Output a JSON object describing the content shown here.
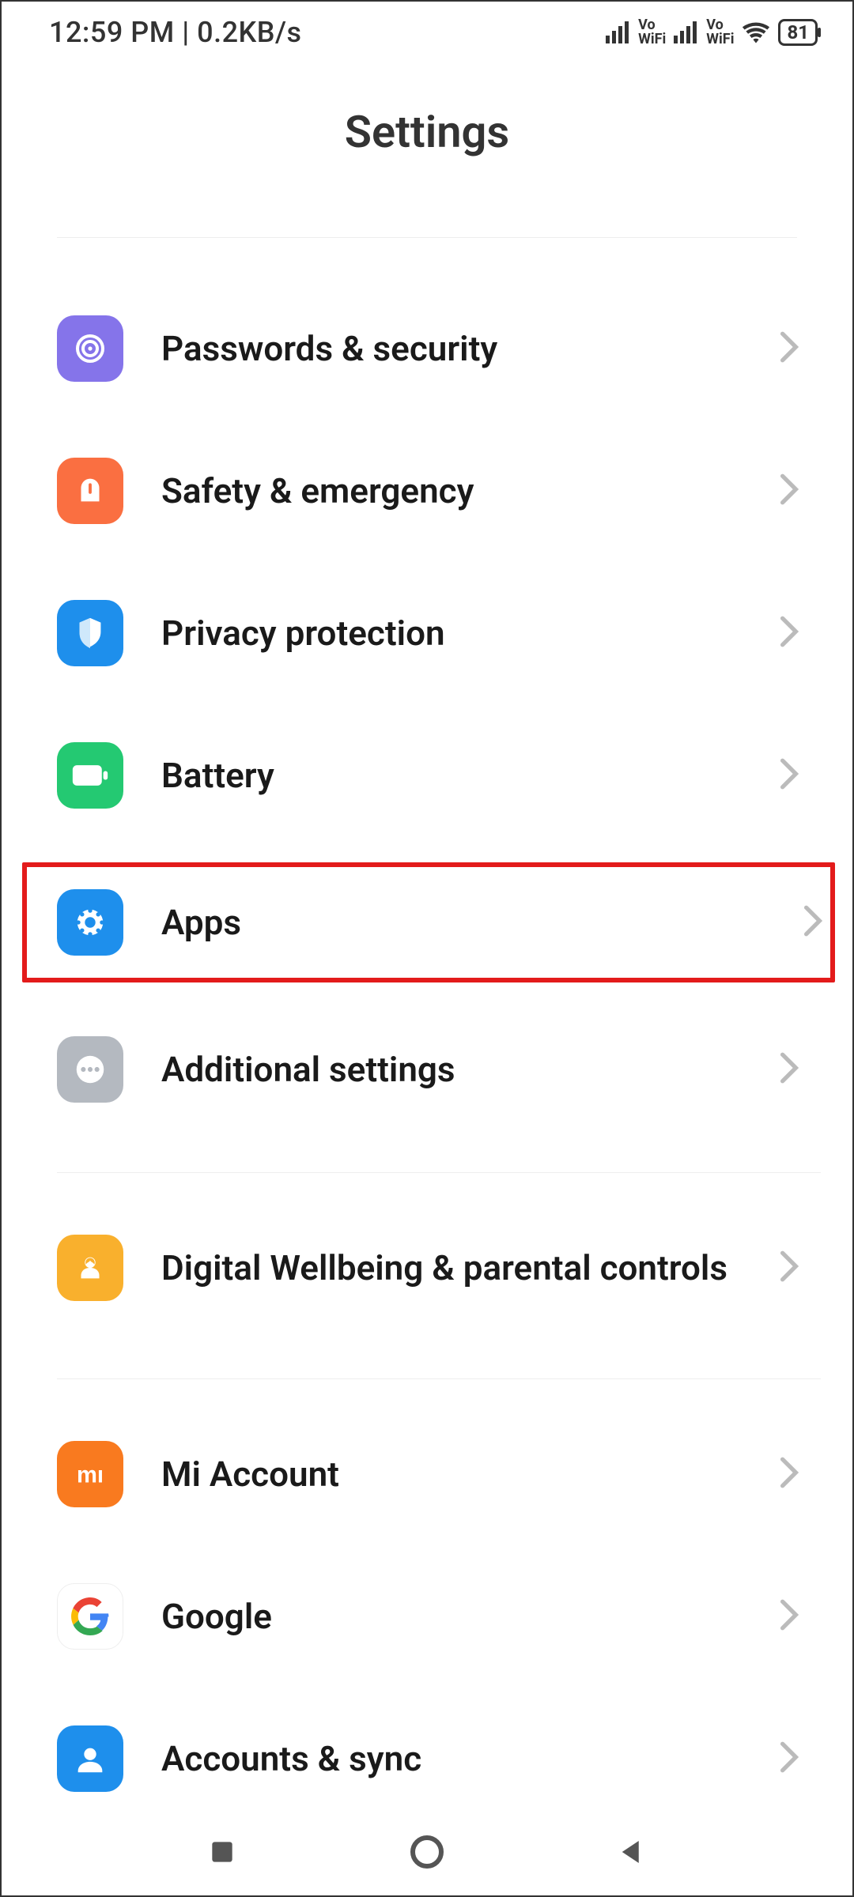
{
  "status": {
    "time": "12:59 PM",
    "net_speed": "0.2KB/s",
    "vowifi_label": "Vo\nWiFi",
    "battery": "81"
  },
  "header": {
    "title": "Settings"
  },
  "groups": [
    {
      "items": [
        {
          "icon": "fingerprint-icon",
          "color": "#8574ea",
          "label": "Passwords & security"
        },
        {
          "icon": "emergency-icon",
          "color": "#fa6f41",
          "label": "Safety & emergency"
        },
        {
          "icon": "privacy-icon",
          "color": "#1e8fec",
          "label": "Privacy protection"
        },
        {
          "icon": "battery-icon",
          "color": "#24c972",
          "label": "Battery"
        },
        {
          "icon": "apps-icon",
          "color": "#1e8fec",
          "label": "Apps",
          "highlight": true
        },
        {
          "icon": "additional-icon",
          "color": "#b4b9c0",
          "label": "Additional settings"
        }
      ]
    },
    {
      "items": [
        {
          "icon": "wellbeing-icon",
          "color": "#f9b02d",
          "label": "Digital Wellbeing & parental controls"
        }
      ]
    },
    {
      "items": [
        {
          "icon": "mi-icon",
          "color": "#f97a1f",
          "label": "Mi Account"
        },
        {
          "icon": "google-icon",
          "color": "#ffffff",
          "label": "Google"
        },
        {
          "icon": "accounts-icon",
          "color": "#1e8fec",
          "label": "Accounts & sync"
        }
      ]
    }
  ]
}
